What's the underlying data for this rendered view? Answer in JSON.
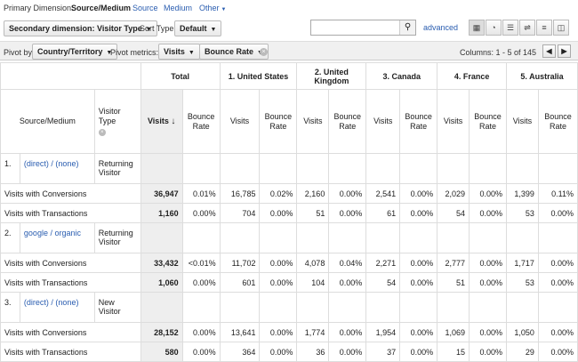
{
  "primary_dimension": {
    "label": "Primary Dimension:",
    "current": "Source/Medium",
    "options": [
      "Source",
      "Medium",
      "Other"
    ]
  },
  "toolbar": {
    "secondary_dimension": "Secondary dimension: Visitor Type",
    "sort_type_label": "Sort Type:",
    "sort_type_value": "Default",
    "search_value": "",
    "advanced_label": "advanced",
    "view_icons": [
      "data-table-icon",
      "pie-chart-icon",
      "performance-icon",
      "comparison-icon",
      "term-cloud-icon",
      "pivot-icon"
    ]
  },
  "pivot": {
    "pivot_by_label": "Pivot by:",
    "pivot_by_value": "Country/Territory",
    "metrics_label": "Pivot metrics:",
    "metric1": "Visits",
    "metric2": "Bounce Rate",
    "columns_label": "Columns:",
    "columns_range": "1 - 5 of 145"
  },
  "table": {
    "country_headers": [
      "Total",
      "1. United States",
      "2. United Kingdom",
      "3. Canada",
      "4. France",
      "5. Australia"
    ],
    "sub_headers": {
      "source": "Source/Medium",
      "visitor_type": "Visitor Type",
      "visits": "Visits",
      "bounce": "Bounce Rate"
    },
    "groups": [
      {
        "index": "1.",
        "source": "(direct) / (none)",
        "visitor_type": "Returning Visitor",
        "rows": [
          {
            "label": "Visits with Conversions",
            "values": [
              "36,947",
              "0.01%",
              "16,785",
              "0.02%",
              "2,160",
              "0.00%",
              "2,541",
              "0.00%",
              "2,029",
              "0.00%",
              "1,399",
              "0.11%"
            ]
          },
          {
            "label": "Visits with Transactions",
            "values": [
              "1,160",
              "0.00%",
              "704",
              "0.00%",
              "51",
              "0.00%",
              "61",
              "0.00%",
              "54",
              "0.00%",
              "53",
              "0.00%"
            ]
          }
        ]
      },
      {
        "index": "2.",
        "source": "google / organic",
        "visitor_type": "Returning Visitor",
        "rows": [
          {
            "label": "Visits with Conversions",
            "values": [
              "33,432",
              "<0.01%",
              "11,702",
              "0.00%",
              "4,078",
              "0.04%",
              "2,271",
              "0.00%",
              "2,777",
              "0.00%",
              "1,717",
              "0.00%"
            ]
          },
          {
            "label": "Visits with Transactions",
            "values": [
              "1,060",
              "0.00%",
              "601",
              "0.00%",
              "104",
              "0.00%",
              "54",
              "0.00%",
              "51",
              "0.00%",
              "53",
              "0.00%"
            ]
          }
        ]
      },
      {
        "index": "3.",
        "source": "(direct) / (none)",
        "visitor_type": "New Visitor",
        "rows": [
          {
            "label": "Visits with Conversions",
            "values": [
              "28,152",
              "0.00%",
              "13,641",
              "0.00%",
              "1,774",
              "0.00%",
              "1,954",
              "0.00%",
              "1,069",
              "0.00%",
              "1,050",
              "0.00%"
            ]
          },
          {
            "label": "Visits with Transactions",
            "values": [
              "580",
              "0.00%",
              "364",
              "0.00%",
              "36",
              "0.00%",
              "37",
              "0.00%",
              "15",
              "0.00%",
              "29",
              "0.00%"
            ]
          }
        ]
      }
    ]
  }
}
